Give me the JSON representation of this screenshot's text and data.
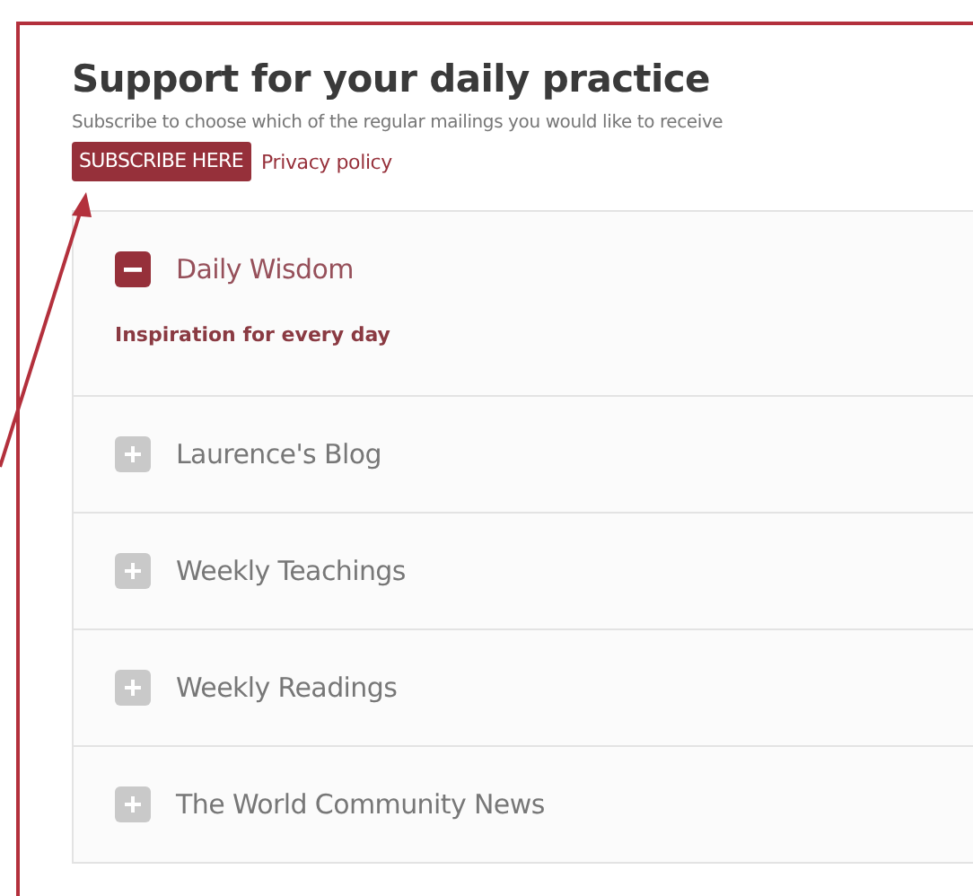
{
  "heading": "Support for your daily practice",
  "subtitle": "Subscribe to choose which of the regular mailings you would like to receive",
  "subscribe_button": "SUBSCRIBE HERE",
  "privacy_link": "Privacy policy",
  "accordion": [
    {
      "title": "Daily Wisdom",
      "expanded": true,
      "content": "Inspiration for every day"
    },
    {
      "title": "Laurence's Blog",
      "expanded": false
    },
    {
      "title": "Weekly Teachings",
      "expanded": false
    },
    {
      "title": "Weekly Readings",
      "expanded": false
    },
    {
      "title": "The World Community News",
      "expanded": false
    }
  ]
}
